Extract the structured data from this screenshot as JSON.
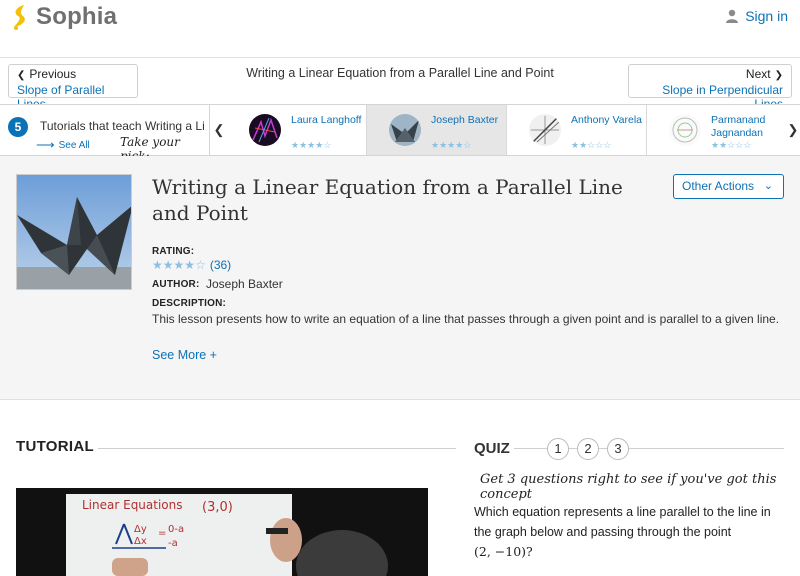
{
  "header": {
    "logo_text": "Sophia",
    "signin_label": "Sign in",
    "brand_color": "#f2c20a",
    "link_color": "#0c72b6"
  },
  "nav": {
    "previous_label": "Previous",
    "previous_title": "Slope of Parallel Lines",
    "next_label": "Next",
    "next_title": "Slope in Perpendicular Lines",
    "current_title": "Writing a Linear Equation from a Parallel Line and Point"
  },
  "tutorials": {
    "count": "5",
    "label": "Tutorials that teach Writing a Linear Equation from a Parallel Line and Point",
    "see_all": "See All",
    "pick_text": "Take your pick:",
    "items": [
      {
        "name": "Laura Langhoff",
        "rating": 4,
        "selected": false
      },
      {
        "name": "Joseph Baxter",
        "rating": 4,
        "selected": true
      },
      {
        "name": "Anthony Varela",
        "rating": 2,
        "selected": false
      },
      {
        "name": "Parmanand Jagnandan",
        "rating": 2,
        "selected": false
      }
    ]
  },
  "lesson": {
    "title": "Writing a Linear Equation from a Parallel Line and Point",
    "other_actions": "Other Actions",
    "rating_label": "RATING:",
    "rating": 4,
    "rating_count": "(36)",
    "author_label": "AUTHOR:",
    "author": "Joseph Baxter",
    "description_label": "DESCRIPTION:",
    "description": "This lesson presents how to write an equation of a line that passes through a given point and is parallel to a given line.",
    "see_more": "See More +"
  },
  "tutorial_section": {
    "heading": "TUTORIAL",
    "board_title": "Linear Equations",
    "board_point": "(3,0)"
  },
  "quiz": {
    "heading": "QUIZ",
    "numbers": [
      "1",
      "2",
      "3"
    ],
    "hint": "Get 3 questions right to see if you've got this concept",
    "question": "Which equation represents a line parallel to the line in the graph below and passing through the point",
    "point": "(2, −10)?"
  }
}
